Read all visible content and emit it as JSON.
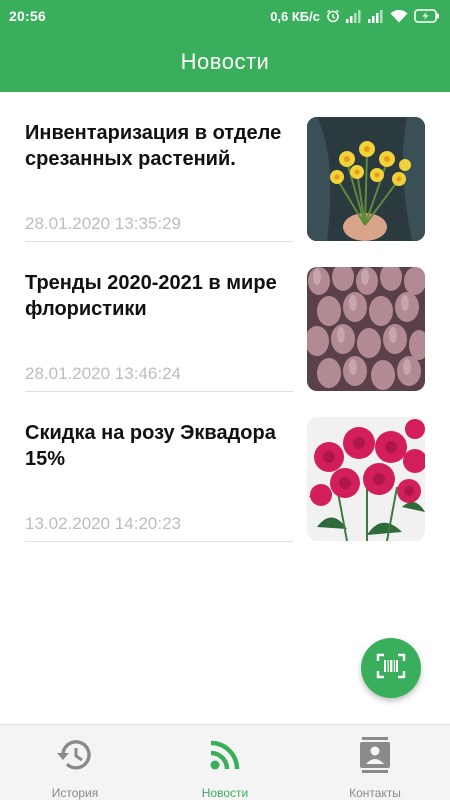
{
  "status_bar": {
    "time": "20:56",
    "network_speed": "0,6 КБ/с",
    "icons": [
      "alarm-icon",
      "signal-icon",
      "signal-icon",
      "wifi-icon",
      "battery-charging-icon"
    ]
  },
  "app_bar": {
    "title": "Новости"
  },
  "news": [
    {
      "title": "Инвентаризация в отделе срезанных растений.",
      "date": "28.01.2020 13:35:29",
      "image": "daffodils-photo"
    },
    {
      "title": "Тренды 2020-2021 в мире флористики",
      "date": "28.01.2020 13:46:24",
      "image": "tulips-photo"
    },
    {
      "title": "Скидка на розу Эквадора 15%",
      "date": "13.02.2020 14:20:23",
      "image": "pink-roses-photo"
    }
  ],
  "fab": {
    "icon": "barcode-scan-icon"
  },
  "bottom_nav": {
    "active": "Новости",
    "items": [
      {
        "label": "История",
        "icon": "history-icon"
      },
      {
        "label": "Новости",
        "icon": "rss-feed-icon"
      },
      {
        "label": "Контакты",
        "icon": "contacts-icon"
      }
    ]
  },
  "colors": {
    "primary": "#3aaf5b",
    "date_text": "#bdbdbd",
    "nav_inactive": "#8a8a8a"
  }
}
